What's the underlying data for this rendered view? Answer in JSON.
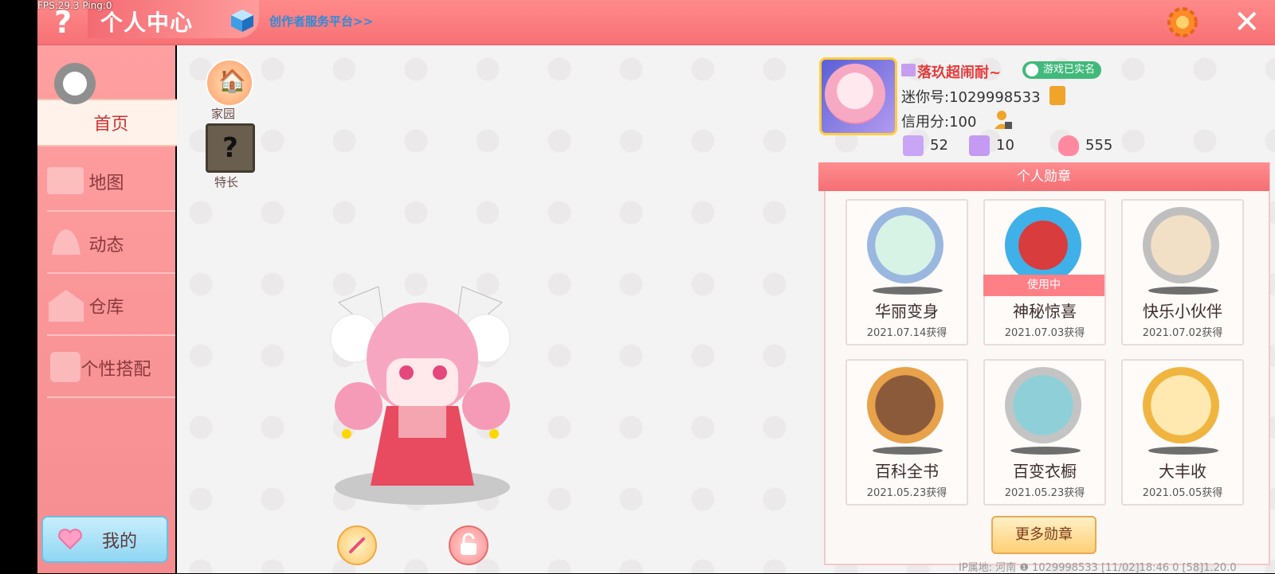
{
  "debug": {
    "fps": "FPS:29.3 Ping:0"
  },
  "header": {
    "title": "个人中心",
    "creator_link": "创作者服务平台>>",
    "help_icon": "?",
    "close_icon": "✕"
  },
  "sidebar": {
    "items": [
      {
        "label": "首页"
      },
      {
        "label": "地图"
      },
      {
        "label": "动态"
      },
      {
        "label": "仓库"
      },
      {
        "label": "个性搭配"
      }
    ],
    "me_label": "我的"
  },
  "home": {
    "homeland_label": "家园",
    "specialty_label": "特长",
    "specialty_icon": "?"
  },
  "profile": {
    "nickname": "落玖超闹耐~",
    "real_name_badge": "游戏已实名",
    "mini_id": "迷你号:1029998533",
    "credit": "信用分:100",
    "stats": [
      {
        "value": "52",
        "color": "#c9a5f5"
      },
      {
        "value": "10",
        "color": "#c49af3"
      },
      {
        "value": "555",
        "color": "#ff8aa0"
      }
    ]
  },
  "medals": {
    "title": "个人勋章",
    "items": [
      {
        "name": "华丽变身",
        "date": "2021.07.14获得",
        "ring": "#9ab7e0",
        "core": "#d7f3e6",
        "in_use": false
      },
      {
        "name": "神秘惊喜",
        "date": "2021.07.03获得",
        "ring": "#3fb1e8",
        "core": "#d83c3c",
        "in_use": true,
        "in_use_label": "使用中"
      },
      {
        "name": "快乐小伙伴",
        "date": "2021.07.02获得",
        "ring": "#bfbfbf",
        "core": "#f2e0c6",
        "in_use": false
      },
      {
        "name": "百科全书",
        "date": "2021.05.23获得",
        "ring": "#e8a24a",
        "core": "#8a5a3a",
        "in_use": false
      },
      {
        "name": "百变衣橱",
        "date": "2021.05.23获得",
        "ring": "#c4c4c4",
        "core": "#8fd0d8",
        "in_use": false
      },
      {
        "name": "大丰收",
        "date": "2021.05.05获得",
        "ring": "#f0b541",
        "core": "#ffe9b0",
        "in_use": false
      }
    ],
    "more_label": "更多勋章"
  },
  "footer": {
    "text": "IP属地: 河南 ❶    1029998533   [11/02]18:46 0   [58]1.20.0"
  }
}
